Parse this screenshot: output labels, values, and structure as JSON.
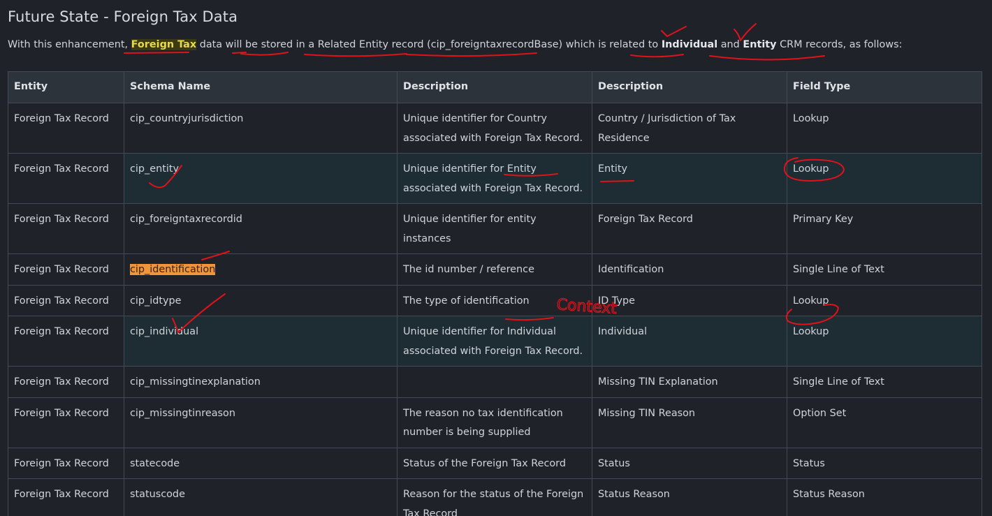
{
  "title": "Future State - Foreign Tax Data",
  "intro": {
    "part1": "With this enhancement,",
    "foreign_tax": "Foreign Tax",
    "part2": "data will be stored in a Related Entity record (cip_foreigntaxrecordBase) which is related to",
    "individual": "Individual",
    "and": "and",
    "entity": "Entity",
    "part3": "CRM records, as follows:"
  },
  "table": {
    "headers": [
      "Entity",
      "Schema Name",
      "Description",
      "Description",
      "Field Type"
    ],
    "rows": [
      [
        "Foreign Tax Record",
        "cip_countryjurisdiction",
        "Unique identifier for Country associated with Foreign Tax Record.",
        "Country / Jurisdiction of Tax Residence",
        "Lookup"
      ],
      [
        "Foreign Tax Record",
        "cip_entity",
        "Unique identifier for Entity associated with Foreign Tax Record.",
        "Entity",
        "Lookup"
      ],
      [
        "Foreign Tax Record",
        "cip_foreigntaxrecordid",
        "Unique identifier for entity instances",
        "Foreign Tax Record",
        "Primary Key"
      ],
      [
        "Foreign Tax Record",
        "cip_identification",
        "The id number / reference",
        "Identification",
        "Single Line of Text"
      ],
      [
        "Foreign Tax Record",
        "cip_idtype",
        "The type of identification",
        "ID Type",
        "Lookup"
      ],
      [
        "Foreign Tax Record",
        "cip_individual",
        "Unique identifier for Individual associated with Foreign Tax Record.",
        "Individual",
        "Lookup"
      ],
      [
        "Foreign Tax Record",
        "cip_missingtinexplanation",
        "",
        "Missing TIN Explanation",
        "Single Line of Text"
      ],
      [
        "Foreign Tax Record",
        "cip_missingtinreason",
        "The reason no tax identification number is being supplied",
        "Missing TIN Reason",
        "Option Set"
      ],
      [
        "Foreign Tax Record",
        "statecode",
        "Status of the Foreign Tax Record",
        "Status",
        "Status"
      ],
      [
        "Foreign Tax Record",
        "statuscode",
        "Reason for the status of the Foreign Tax Record",
        "Status Reason",
        "Status Reason"
      ]
    ]
  },
  "annotations": {
    "handwritten_word": "Context",
    "ink_color": "#e0121a"
  }
}
